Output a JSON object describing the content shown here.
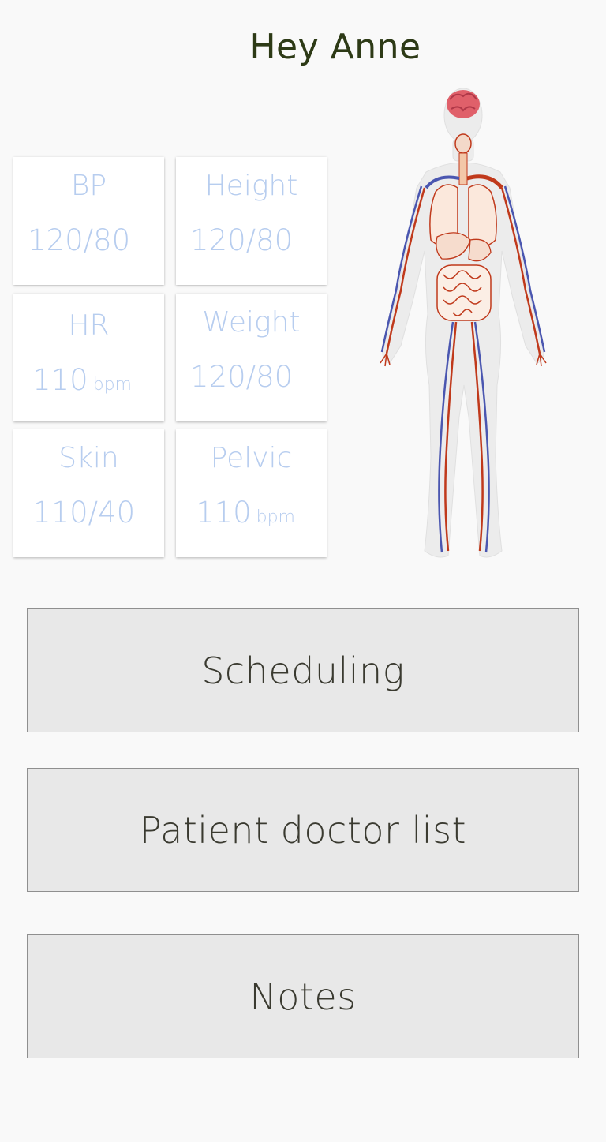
{
  "header": {
    "greeting": "Hey Anne"
  },
  "vitals": [
    {
      "label": "BP",
      "value": "120/80",
      "unit": ""
    },
    {
      "label": "Height",
      "value": "120/80",
      "unit": ""
    },
    {
      "label": "HR",
      "value": "110",
      "unit": "bpm"
    },
    {
      "label": "Weight",
      "value": "120/80",
      "unit": ""
    },
    {
      "label": "Skin",
      "value": "110/40",
      "unit": ""
    },
    {
      "label": "Pelvic",
      "value": "110",
      "unit": "bpm"
    }
  ],
  "illustration": {
    "icon": "human-circulatory-system-illustration"
  },
  "actions": {
    "scheduling": "Scheduling",
    "patient_doctor_list": "Patient doctor list",
    "notes": "Notes"
  },
  "colors": {
    "background": "#f9f9f9",
    "card_text": "#b7cdef",
    "greeting_text": "#2d3a16",
    "button_fill": "#e8e8e8",
    "button_border": "#8f8f8f",
    "artery_red": "#c0391b",
    "vein_blue": "#4a56b0"
  }
}
